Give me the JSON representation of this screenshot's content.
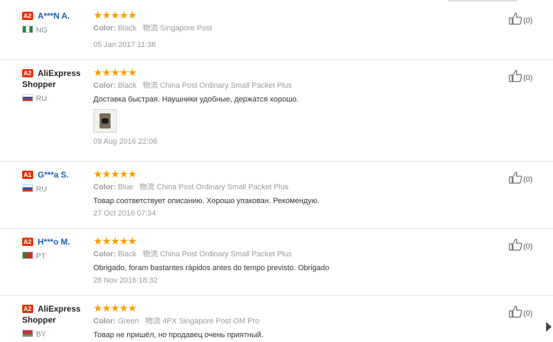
{
  "colors": {
    "star": "#f5a000",
    "level_badge": "#e62e04",
    "username": "#1a5fb4"
  },
  "labels": {
    "color": "Color:",
    "shipping": "物流"
  },
  "reviews": [
    {
      "level": "A2",
      "name": "A***N A.",
      "country": "NG",
      "stars": "★★★★★",
      "color": "Black",
      "shipping": "Singapore Post",
      "text": "",
      "date": "05 Jan 2017 11:38",
      "useful_count": "(0)"
    },
    {
      "level": "A2",
      "name_line1": "AliExpress",
      "name_line2": "Shopper",
      "country": "RU",
      "stars": "★★★★★",
      "color": "Black",
      "shipping": "China Post Ordinary Small Packet Plus",
      "text": "Доставка быстрая. Наушники удобные, держатся хорошо.",
      "date": "09 Aug 2016 22:08",
      "useful_count": "(0)"
    },
    {
      "level": "A1",
      "name": "G***a S.",
      "country": "RU",
      "stars": "★★★★★",
      "color": "Blue",
      "shipping": "China Post Ordinary Small Packet Plus",
      "text": "Товар соответствует описанию. Хорошо упакован. Рекомендую.",
      "date": "27 Oct 2016 07:34",
      "useful_count": "(0)"
    },
    {
      "level": "A2",
      "name": "H***o M.",
      "country": "PT",
      "stars": "★★★★★",
      "color": "Black",
      "shipping": "China Post Ordinary Small Packet Plus",
      "text": "Obrigado, foram bastantes rápidos antes do tempo previsto. Obrigado",
      "date": "28 Nov 2016 18:32",
      "useful_count": "(0)"
    },
    {
      "level": "A2",
      "name_line1": "AliExpress",
      "name_line2": "Shopper",
      "country": "BY",
      "stars": "★★★★★",
      "color": "Green",
      "shipping": "4PX Singapore Post OM Pro",
      "text": "Товар не пришёл, но продавец очень приятный.",
      "date": "",
      "useful_count": "(0)"
    }
  ]
}
